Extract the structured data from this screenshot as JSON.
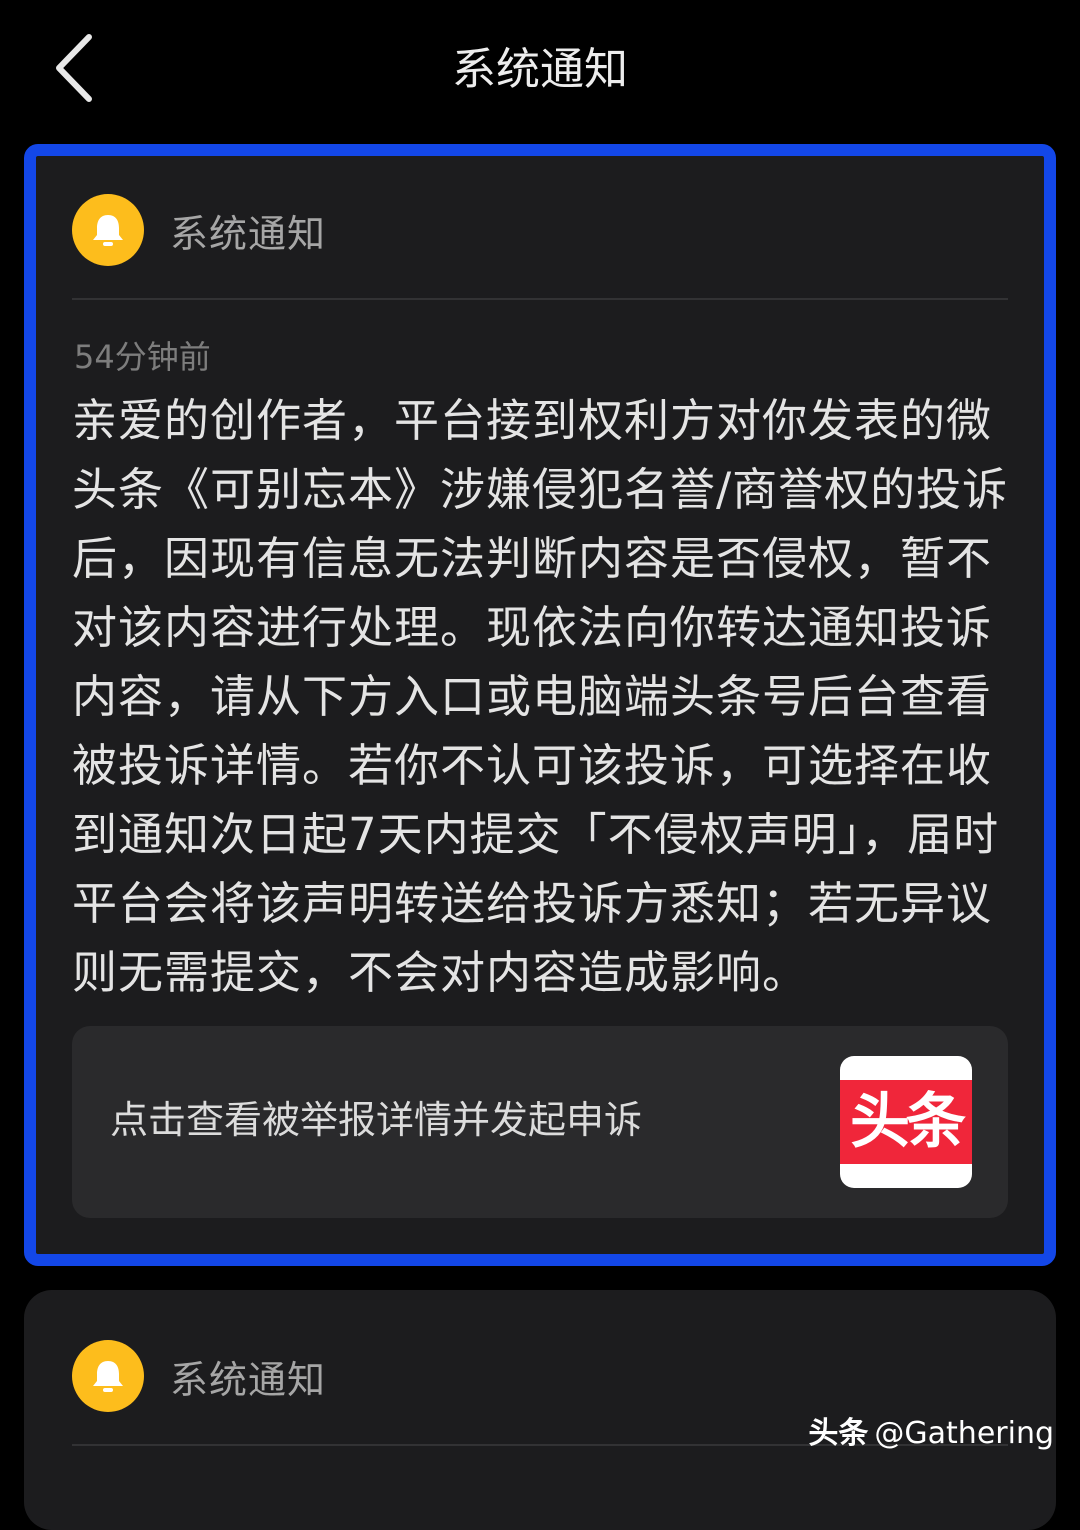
{
  "nav": {
    "title": "系统通知",
    "back_icon": "chevron-left-icon"
  },
  "colors": {
    "background": "#000000",
    "card": "#1c1c1e",
    "highlight_border": "#1347e8",
    "bell_avatar": "#fdbd1c",
    "logo_red": "#f0263a"
  },
  "notifications": [
    {
      "sender": "系统通知",
      "avatar_icon": "bell-icon",
      "time": "54分钟前",
      "message": "亲爱的创作者，平台接到权利方对你发表的微头条《可别忘本》涉嫌侵犯名誉/商誉权的投诉后，因现有信息无法判断内容是否侵权，暂不对该内容进行处理。现依法向你转达通知投诉内容，请从下方入口或电脑端头条号后台查看被投诉详情。若你不认可该投诉，可选择在收到通知次日起7天内提交「不侵权声明」，届时平台会将该声明转送给投诉方悉知；若无异议则无需提交，不会对内容造成影响。",
      "action": {
        "label": "点击查看被举报详情并发起申诉",
        "logo_text": "头条"
      }
    },
    {
      "sender": "系统通知",
      "avatar_icon": "bell-icon"
    }
  ],
  "watermark": {
    "brand": "头条",
    "handle": "@Gathering"
  }
}
